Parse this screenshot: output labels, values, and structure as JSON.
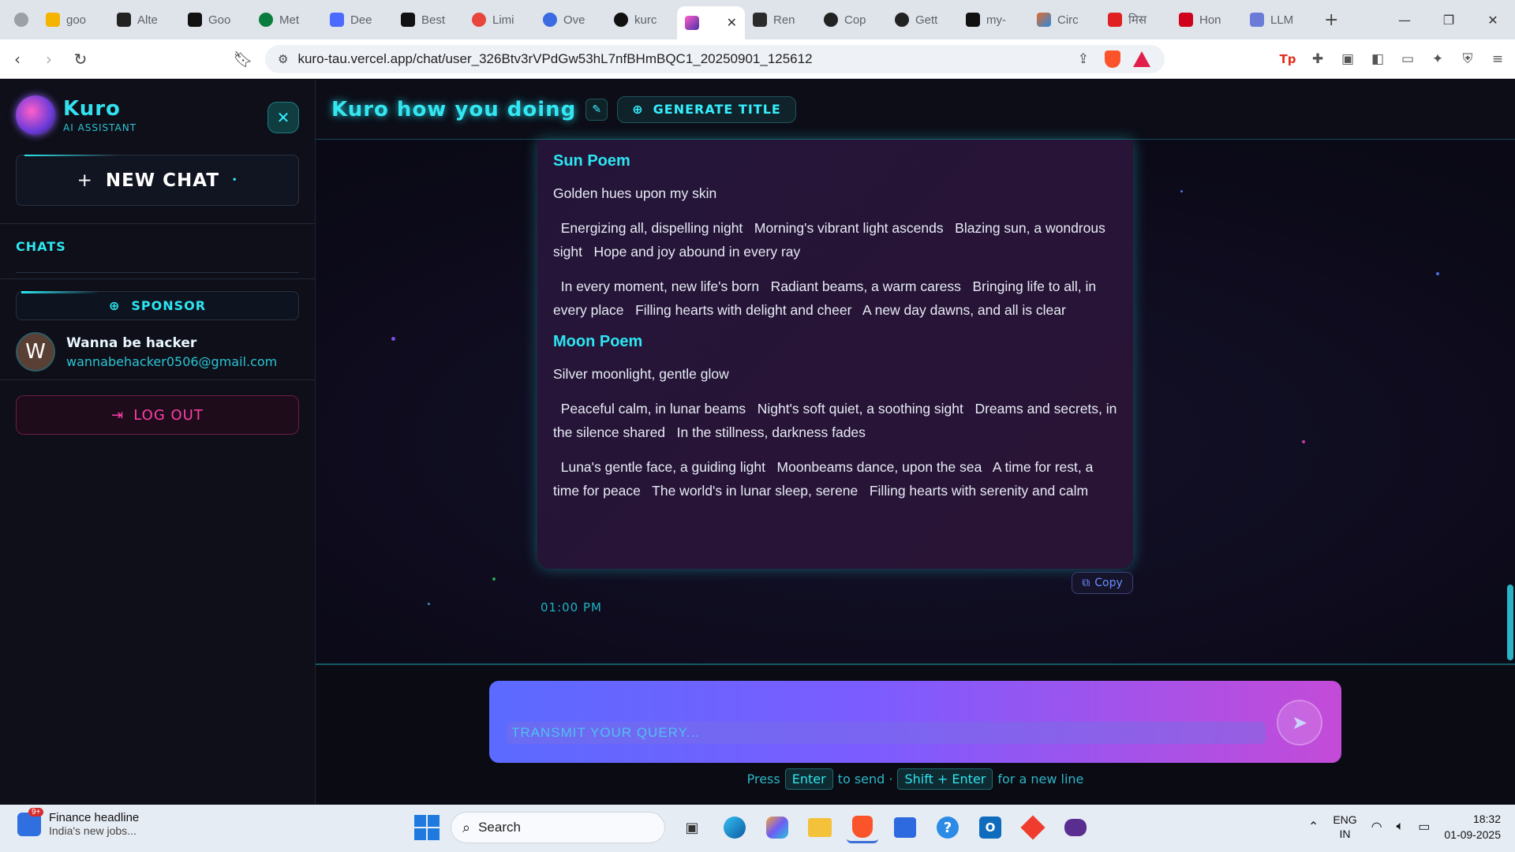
{
  "browser": {
    "tabs": [
      {
        "label": "goo",
        "color": "#f5b400"
      },
      {
        "label": "Alte",
        "color": "#222222"
      },
      {
        "label": "Goo",
        "color": "#111111"
      },
      {
        "label": "Met",
        "color": "#0a7d3e"
      },
      {
        "label": "Dee",
        "color": "#4b6bff"
      },
      {
        "label": "Best",
        "color": "#111111"
      },
      {
        "label": "Limi",
        "color": "#e8453c"
      },
      {
        "label": "Ove",
        "color": "#3a6be0"
      },
      {
        "label": "kurc",
        "color": "#111111"
      }
    ],
    "active_tab": {
      "label": ""
    },
    "tabs_after": [
      {
        "label": "Ren",
        "color": "#2b2b2b"
      },
      {
        "label": "Cop",
        "color": "#222222"
      },
      {
        "label": "Gett",
        "color": "#222222"
      },
      {
        "label": "my-",
        "color": "#111111"
      },
      {
        "label": "Circ",
        "color": "#e06b2a"
      },
      {
        "label": "मिस",
        "color": "#e02020"
      },
      {
        "label": "Hon",
        "color": "#d0021b"
      },
      {
        "label": "LLM",
        "color": "#6a7bd8"
      }
    ],
    "url": "kuro-tau.vercel.app/chat/user_326Btv3rVPdGw53hL7nfBHmBQC1_20250901_125612"
  },
  "sidebar": {
    "brand_name": "Kuro",
    "brand_sub": "AI ASSISTANT",
    "new_chat_label": "NEW CHAT",
    "chats_label": "CHATS",
    "sponsor_label": "SPONSOR",
    "user": {
      "initial": "W",
      "name": "Wanna be hacker",
      "email": "wannabehacker0506@gmail.com"
    },
    "logout_label": "LOG OUT"
  },
  "header": {
    "title": "Kuro how you doing",
    "generate_label": "GENERATE TITLE"
  },
  "message": {
    "sun_heading": "Sun Poem",
    "sun_line1": "Golden hues upon my skin",
    "sun_para2": "  Energizing all, dispelling night   Morning's vibrant light ascends   Blazing sun, a wondrous sight   Hope and joy abound in every ray",
    "sun_para3": "  In every moment, new life's born   Radiant beams, a warm caress   Bringing life to all, in every place   Filling hearts with delight and cheer   A new day dawns, and all is clear",
    "moon_heading": "Moon Poem",
    "moon_line1": "Silver moonlight, gentle glow",
    "moon_para2": "  Peaceful calm, in lunar beams   Night's soft quiet, a soothing sight   Dreams and secrets, in the silence shared   In the stillness, darkness fades",
    "moon_para3": "  Luna's gentle face, a guiding light   Moonbeams dance, upon the sea   A time for rest, a time for peace   The world's in lunar sleep, serene   Filling hearts with serenity and calm",
    "copy_label": "Copy",
    "time": "01:00 PM"
  },
  "composer": {
    "placeholder": "TRANSMIT YOUR QUERY...",
    "hint_press": "Press",
    "hint_enter": "Enter",
    "hint_to_send": "to send ·",
    "hint_shift": "Shift + Enter",
    "hint_newline": "for a new line"
  },
  "taskbar": {
    "news_title": "Finance headline",
    "news_sub": "India's new jobs...",
    "news_badge": "9+",
    "search_label": "Search",
    "lang_top": "ENG",
    "lang_bottom": "IN",
    "time": "18:32",
    "date": "01-09-2025"
  },
  "colors": {
    "accent": "#2de6f2",
    "logout": "#ff3fa8"
  }
}
